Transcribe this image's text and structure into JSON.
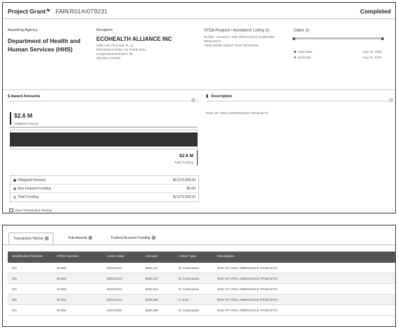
{
  "header": {
    "title": "Project Grant",
    "fain_label": "FAIN",
    "fain_value": "R01AI079231",
    "status": "Completed"
  },
  "agency": {
    "label": "Awarding Agency",
    "name_line1": "Department of Health and",
    "name_line2": "Human Services (HHS)"
  },
  "recipient": {
    "label": "Recipient",
    "name": "ECOHEALTH ALLIANCE INC",
    "address": [
      "1200 LINCOLN AVE FL 12",
      "PROSPECT PARK, NJ 07508-2331",
      "Congressional District: 09",
      "UNITED STATES"
    ]
  },
  "cfda": {
    "label": "CFDA Program / Assistance Listing",
    "lines": [
      "93.855 - ALLERGY AND INFECTIOUS DISEASES",
      "RESEARCH",
      "VIEW MORE ABOUT THIS PROGRAM"
    ]
  },
  "dates": {
    "label": "Dates",
    "start_label": "Start Date",
    "start_value": "Sep 18, 2009",
    "end_label": "End Date",
    "end_value": "Aug 31, 2019"
  },
  "award_amounts": {
    "title": "$ Award Amounts",
    "obligated_value": "$2.6 M",
    "obligated_label": "Obligated Amount",
    "total_value": "$2.6 M",
    "total_label": "Total Funding",
    "rows": [
      {
        "label": "Obligated Amount",
        "value": "$2,579,558.00",
        "color": "#444444"
      },
      {
        "label": "Non-Federal Funding",
        "value": "$0.00",
        "color": "#888888"
      },
      {
        "label": "Total Funding",
        "value": "$2,579,558.00",
        "color": "#ffffff"
      }
    ],
    "history_link": "View Transaction History"
  },
  "description": {
    "title": "Description",
    "text": "RISK OF VIRAL EMERGENCE FROM BATS"
  },
  "tabs": [
    {
      "label": "Transaction History",
      "badge": "5",
      "active": true
    },
    {
      "label": "Sub-Awards",
      "badge": "0",
      "active": false
    },
    {
      "label": "Federal Account Funding",
      "badge": "9",
      "active": false
    }
  ],
  "table": {
    "columns": [
      "Modification Number",
      "CFDA Number",
      "Action Date",
      "Amount",
      "Action Type",
      "Description"
    ],
    "rows": [
      [
        "001",
        "93.855",
        "08/21/2014",
        "$603,417",
        "B: Continuation",
        "RISK OF VIRAL EMERGENCE FROM BATS"
      ],
      [
        "001",
        "93.855",
        "08/21/2013",
        "$486,427",
        "B: Continuation",
        "RISK OF VIRAL EMERGENCE FROM BATS"
      ],
      [
        "001",
        "93.855",
        "08/21/2012",
        "$480,344",
        "B: Continuation",
        "RISK OF VIRAL EMERGENCE FROM BATS"
      ],
      [
        "001",
        "93.855",
        "08/21/2010",
        "$499,280",
        "A: New",
        "RISK OF VIRAL EMERGENCE FROM BATS"
      ],
      [
        "001",
        "93.855",
        "08/21/2009",
        "$509,090",
        "B: Continuation",
        "RISK OF VIRAL EMERGENCE FROM BATS"
      ]
    ]
  }
}
